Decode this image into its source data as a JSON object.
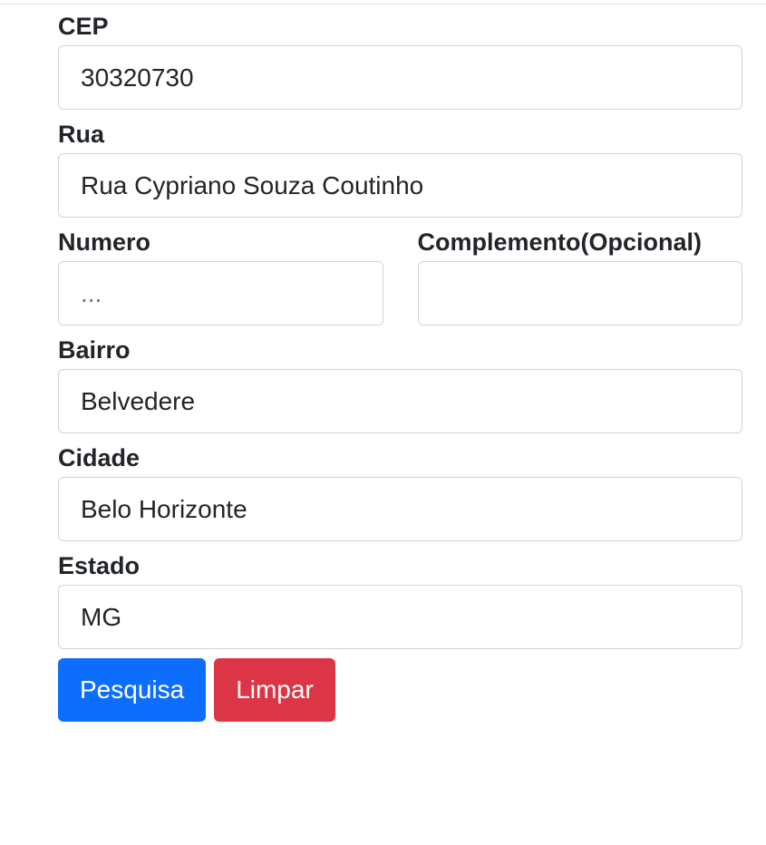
{
  "form": {
    "cep": {
      "label": "CEP",
      "value": "30320730",
      "placeholder": ""
    },
    "rua": {
      "label": "Rua",
      "value": "Rua Cypriano Souza Coutinho",
      "placeholder": ""
    },
    "numero": {
      "label": "Numero",
      "value": "",
      "placeholder": "..."
    },
    "complemento": {
      "label": "Complemento(Opcional)",
      "value": "",
      "placeholder": ""
    },
    "bairro": {
      "label": "Bairro",
      "value": "Belvedere",
      "placeholder": ""
    },
    "cidade": {
      "label": "Cidade",
      "value": "Belo Horizonte",
      "placeholder": ""
    },
    "estado": {
      "label": "Estado",
      "value": "MG",
      "placeholder": ""
    }
  },
  "buttons": {
    "search_label": "Pesquisa",
    "clear_label": "Limpar"
  },
  "colors": {
    "primary": "#0d6efd",
    "danger": "#dc3545",
    "border": "#ced4da",
    "text": "#212529"
  }
}
